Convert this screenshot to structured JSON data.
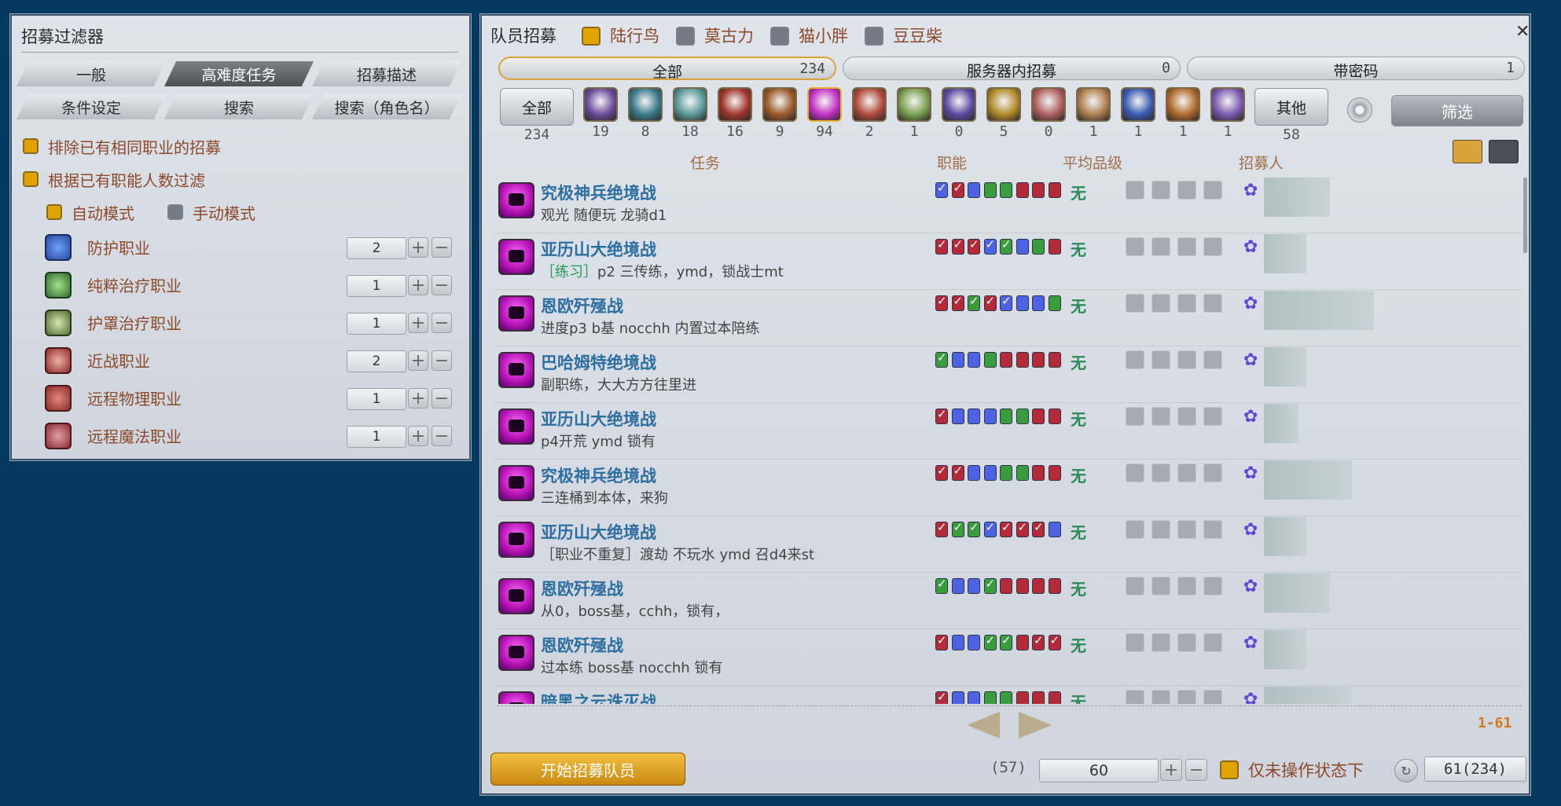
{
  "filter": {
    "title": "招募过滤器",
    "tabs": [
      "一般",
      "高难度任务",
      "招募描述",
      "条件设定",
      "搜索",
      "搜索（角色名）"
    ],
    "active_tab": 1,
    "opt_exclude_same_job": "排除已有相同职业的招募",
    "opt_filter_by_role": "根据已有职能人数过滤",
    "mode_auto": "自动模式",
    "mode_manual": "手动模式",
    "roles": [
      {
        "label": "防护职业",
        "value": "2",
        "icon": "shield-icon"
      },
      {
        "label": "纯粹治疗职业",
        "value": "1",
        "icon": "pure-healer-icon"
      },
      {
        "label": "护罩治疗职业",
        "value": "1",
        "icon": "barrier-healer-icon"
      },
      {
        "label": "近战职业",
        "value": "2",
        "icon": "melee-icon"
      },
      {
        "label": "远程物理职业",
        "value": "1",
        "icon": "ranged-physical-icon"
      },
      {
        "label": "远程魔法职业",
        "value": "1",
        "icon": "ranged-magic-icon"
      }
    ],
    "plus": "+",
    "minus": "−"
  },
  "recruit": {
    "title": "队员招募",
    "worlds": [
      {
        "name": "陆行鸟",
        "checked": true
      },
      {
        "name": "莫古力",
        "checked": false
      },
      {
        "name": "猫小胖",
        "checked": false
      },
      {
        "name": "豆豆柴",
        "checked": false
      }
    ],
    "close": "✕",
    "segments": [
      {
        "label": "全部",
        "count": "234"
      },
      {
        "label": "服务器内招募",
        "count": "0"
      },
      {
        "label": "带密码",
        "count": "1"
      }
    ],
    "cat_all": {
      "label": "全部",
      "count": "234"
    },
    "categories": [
      {
        "count": "19",
        "color": "#6a4a9a"
      },
      {
        "count": "8",
        "color": "#3a7a8a"
      },
      {
        "count": "18",
        "color": "#5a9a9a"
      },
      {
        "count": "16",
        "color": "#a0342a"
      },
      {
        "count": "9",
        "color": "#9a5a2a"
      },
      {
        "count": "94",
        "color": "#c230c2"
      },
      {
        "count": "2",
        "color": "#b04a3a"
      },
      {
        "count": "1",
        "color": "#7aa050"
      },
      {
        "count": "0",
        "color": "#5a4aa0"
      },
      {
        "count": "5",
        "color": "#b08a2a"
      },
      {
        "count": "0",
        "color": "#b06060"
      },
      {
        "count": "1",
        "color": "#b08050"
      },
      {
        "count": "1",
        "color": "#3a5ab0"
      },
      {
        "count": "1",
        "color": "#b06a2a"
      },
      {
        "count": "1",
        "color": "#7a5ab0"
      }
    ],
    "cat_other": {
      "label": "其他",
      "count": "58"
    },
    "filter_btn": "筛选",
    "col_task": "任务",
    "col_role": "职能",
    "col_ilv": "平均品级",
    "col_leader": "招募人",
    "rows": [
      {
        "name": "究极神兵绝境战",
        "tag": "",
        "desc": "观光 随便玩 龙骑d1",
        "slots": "tf,df,t,h,h,d,d,d",
        "ilv": "无",
        "blur": 84
      },
      {
        "name": "亚历山大绝境战",
        "tag": "［练习］",
        "desc": "p2 三传练，ymd，锁战士mt",
        "slots": "df,df,df,tf,hf,t,h,d",
        "ilv": "无",
        "blur": 54
      },
      {
        "name": "恩欧歼殛战",
        "tag": "",
        "desc": "进度p3 b基 nocchh 内置过本陪练",
        "slots": "df,df,hf,df,tf,t,t,h",
        "ilv": "无",
        "blur": 140
      },
      {
        "name": "巴哈姆特绝境战",
        "tag": "",
        "desc": "副职练，大大方方往里进",
        "slots": "hf,t,t,h,d,d,d,d",
        "ilv": "无",
        "blur": 54
      },
      {
        "name": "亚历山大绝境战",
        "tag": "",
        "desc": "p4开荒 ymd 锁有",
        "slots": "df,t,t,t,h,h,d,d",
        "ilv": "无",
        "blur": 44
      },
      {
        "name": "究极神兵绝境战",
        "tag": "",
        "desc": "三连桶到本体，来狗",
        "slots": "df,df,t,t,h,h,d,d",
        "ilv": "无",
        "blur": 112
      },
      {
        "name": "亚历山大绝境战",
        "tag": "",
        "desc": "［职业不重复］渡劫 不玩水 ymd 召d4来st",
        "slots": "df,hf,hf,tf,df,df,df,t",
        "ilv": "无",
        "blur": 54
      },
      {
        "name": "恩欧歼殛战",
        "tag": "",
        "desc": "从0，boss基，cchh，锁有，",
        "slots": "hf,t,t,hf,d,d,d,d",
        "ilv": "无",
        "blur": 84
      },
      {
        "name": "恩欧歼殛战",
        "tag": "",
        "desc": "过本练 boss基 nocchh 锁有",
        "slots": "df,t,t,hf,hf,d,df,df",
        "ilv": "无",
        "blur": 54
      },
      {
        "name": "暗黑之云诛灭战",
        "tag": "",
        "desc": "",
        "slots": "df,t,t,h,h,d,d,d",
        "ilv": "无",
        "blur": 112
      }
    ],
    "page_range": "1-61",
    "start_btn": "开始招募队员",
    "paren_count": "(57)",
    "per_page": "60",
    "only_idle": "仅未操作状态下",
    "total": "61(234)"
  }
}
